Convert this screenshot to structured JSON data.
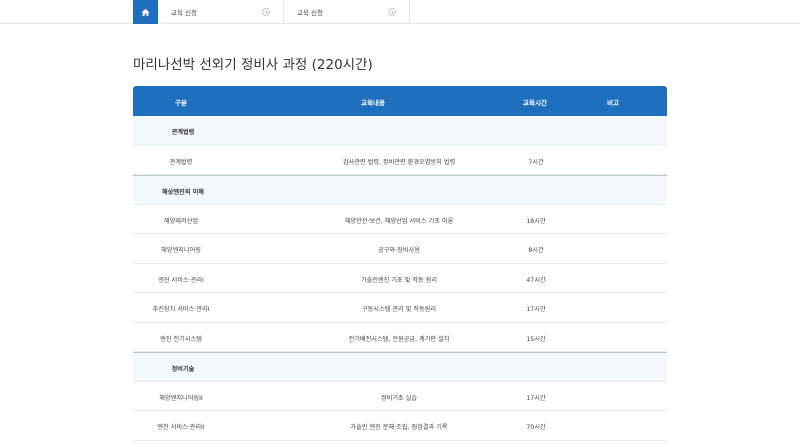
{
  "nav": {
    "crumbs": [
      "교육 신청",
      "교육 신청"
    ]
  },
  "page": {
    "title": "마리나선박 선외기 정비사 과정 (220시간)"
  },
  "table": {
    "headers": {
      "category": "구분",
      "content": "교육내용",
      "hours": "교육시간",
      "note": "비고"
    },
    "rows": [
      {
        "type": "section",
        "category": "관계법령"
      },
      {
        "type": "item",
        "category": "관계법령",
        "content": "검사관련 법령, 정비관련 환경오염방지 법령",
        "hours": "7시간"
      },
      {
        "type": "section",
        "category": "해상엔진의 이해"
      },
      {
        "type": "item",
        "category": "해양레저산업",
        "content": "해양안전·보건, 해양산업 서비스 기초 이론",
        "hours": "18시간"
      },
      {
        "type": "item",
        "category": "해양엔지니어링",
        "content": "공구와 장비사용",
        "hours": "8시간"
      },
      {
        "type": "item",
        "category": "엔진 서비스·관리I",
        "content": "가솔린엔진 기초 및 작동 원리",
        "hours": "47시간"
      },
      {
        "type": "item",
        "category": "추진장치 서비스·관리I",
        "content": "구동시스템 관리 및 작동원리",
        "hours": "17시간"
      },
      {
        "type": "item",
        "category": "엔진 전기시스템",
        "content": "전기배전시스템, 전원공급, 계기판 설치",
        "hours": "15시간"
      },
      {
        "type": "section",
        "category": "정비기술"
      },
      {
        "type": "item",
        "category": "해양엔지니어링II",
        "content": "정비기초 실습",
        "hours": "17시간"
      },
      {
        "type": "item",
        "category": "엔진 서비스·관리II",
        "content": "가솔린 엔진 분해·조립, 점검결과 기록",
        "hours": "70시간"
      }
    ]
  },
  "colors": {
    "header_blue": "#1f6fbf",
    "section_bg": "#f3f8fd"
  }
}
